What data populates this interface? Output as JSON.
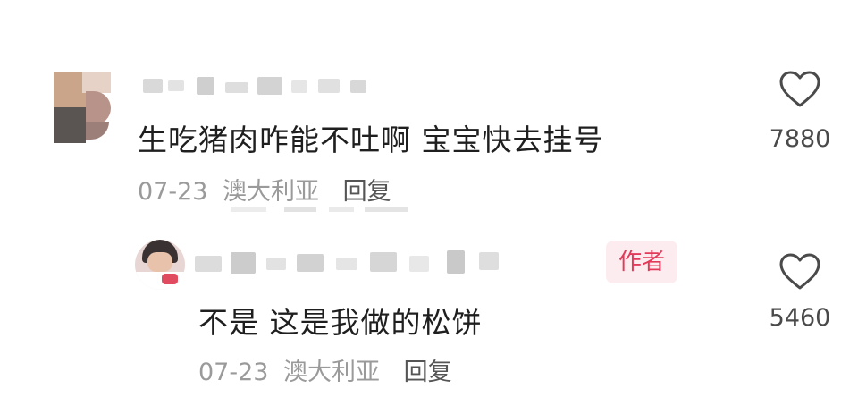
{
  "comments": [
    {
      "avatar": "blurred-avatar",
      "username": "",
      "text": "生吃猪肉咋能不吐啊 宝宝快去挂号",
      "date": "07-23",
      "location": "澳大利亚",
      "reply_label": "回复",
      "like_icon": "heart-outline-icon",
      "likes": "7880"
    },
    {
      "avatar": "blurred-avatar",
      "username": "",
      "author_badge": "作者",
      "text": "不是 这是我做的松饼",
      "date": "07-23",
      "location": "澳大利亚",
      "reply_label": "回复",
      "like_icon": "heart-outline-icon",
      "likes": "5460"
    }
  ],
  "colors": {
    "badge_text": "#e23a5a",
    "badge_bg": "#fdecef",
    "meta_text": "#9a9a9a",
    "main_text": "#1f1f1f"
  }
}
